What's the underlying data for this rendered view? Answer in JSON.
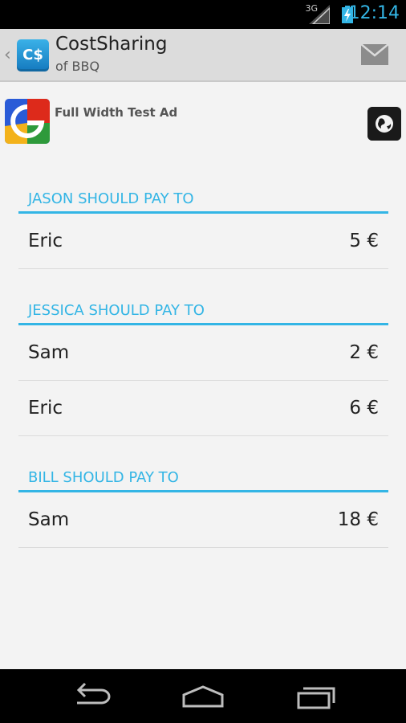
{
  "status": {
    "network": "3G",
    "time": "12:14"
  },
  "actionbar": {
    "logo_text": "C$",
    "title": "CostSharing",
    "subtitle": "of BBQ"
  },
  "ad": {
    "text": "Full Width Test Ad"
  },
  "sections": [
    {
      "header": "JASON SHOULD PAY TO",
      "rows": [
        {
          "name": "Eric",
          "amount": "5 €"
        }
      ]
    },
    {
      "header": "JESSICA SHOULD PAY TO",
      "rows": [
        {
          "name": "Sam",
          "amount": "2 €"
        },
        {
          "name": "Eric",
          "amount": "6 €"
        }
      ]
    },
    {
      "header": "BILL SHOULD PAY TO",
      "rows": [
        {
          "name": "Sam",
          "amount": "18 €"
        }
      ]
    }
  ],
  "colors": {
    "accent": "#33b5e5",
    "actionbar": "#dcdcdc",
    "background": "#f3f3f3"
  }
}
